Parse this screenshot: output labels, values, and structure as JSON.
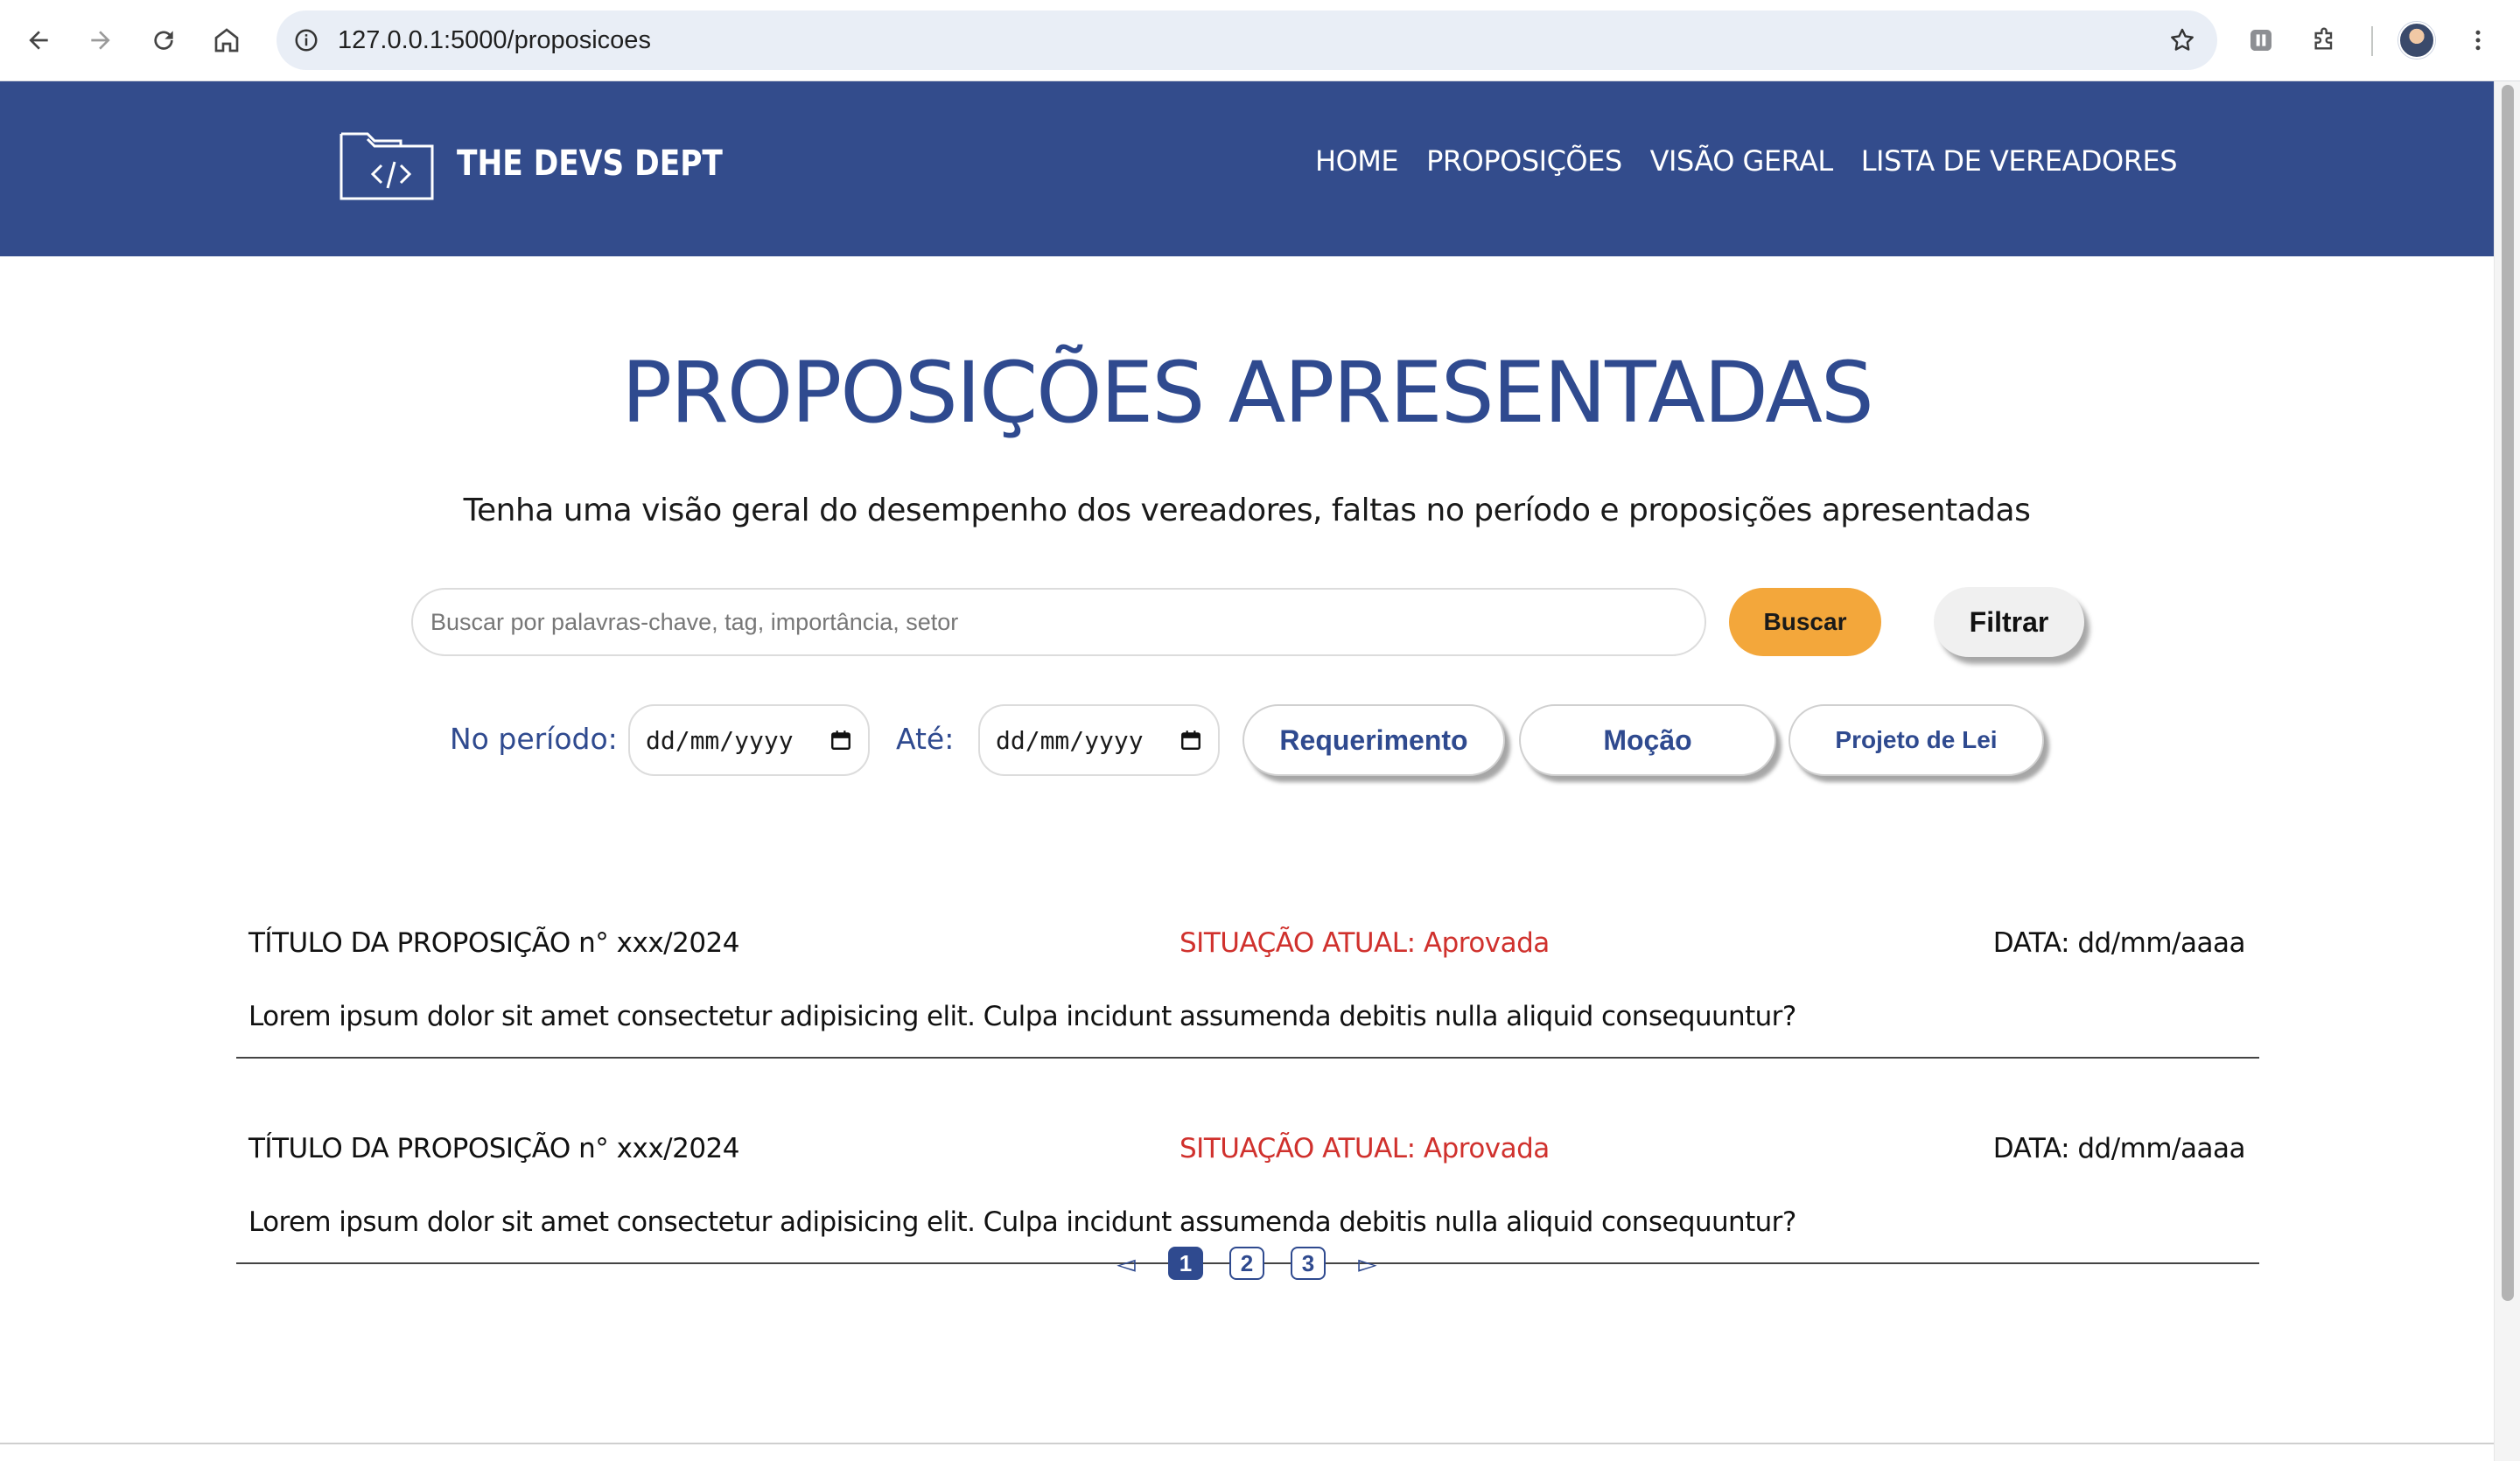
{
  "browser": {
    "url": "127.0.0.1:5000/proposicoes"
  },
  "header": {
    "brand": "THE DEVS DEPT",
    "nav": [
      "HOME",
      "PROPOSIÇÕES",
      "VISÃO GERAL",
      "LISTA DE VEREADORES"
    ]
  },
  "hero": {
    "title": "PROPOSIÇÕES APRESENTADAS",
    "subtitle": "Tenha uma visão geral do desempenho dos vereadores, faltas no período e proposições apresentadas"
  },
  "search": {
    "placeholder": "Buscar por palavras-chave, tag, importância, setor",
    "search_label": "Buscar",
    "filter_label": "Filtrar"
  },
  "filters": {
    "period_label": "No período:",
    "until_label": "Até:",
    "date_from": "dd/mm/yyyy",
    "date_to": "dd/mm/yyyy",
    "types": [
      "Requerimento",
      "Moção",
      "Projeto de Lei"
    ]
  },
  "proposals": [
    {
      "title": "TÍTULO DA PROPOSIÇÃO  n° xxx/2024",
      "status": "SITUAÇÃO ATUAL:  Aprovada",
      "date": "DATA:  dd/mm/aaaa",
      "description": "Lorem ipsum dolor sit amet consectetur adipisicing elit. Culpa incidunt assumenda debitis nulla aliquid consequuntur?"
    },
    {
      "title": "TÍTULO DA PROPOSIÇÃO  n° xxx/2024",
      "status": "SITUAÇÃO ATUAL:  Aprovada",
      "date": "DATA:  dd/mm/aaaa",
      "description": "Lorem ipsum dolor sit amet consectetur adipisicing elit. Culpa incidunt assumenda debitis nulla aliquid consequuntur?"
    }
  ],
  "pagination": {
    "prev": "◅",
    "next": "▻",
    "pages": [
      "1",
      "2",
      "3"
    ],
    "current": "1"
  },
  "colors": {
    "header_bg": "#334c8c",
    "title_blue": "#2f4a8f",
    "buscar_orange": "#f3a73b",
    "status_red": "#d0312d"
  },
  "icons": [
    "back-icon",
    "forward-icon",
    "reload-icon",
    "home-icon",
    "site-info-icon",
    "bookmark-star-icon",
    "extension-icon",
    "puzzle-icon",
    "profile-avatar",
    "kebab-menu-icon",
    "folder-code-icon",
    "calendar-icon"
  ]
}
